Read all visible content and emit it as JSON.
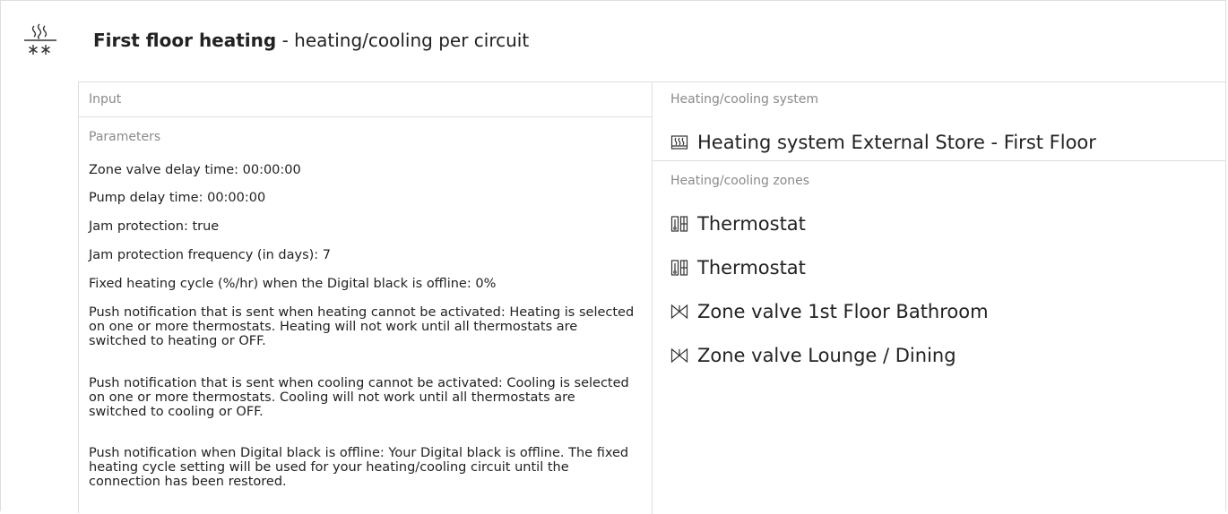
{
  "header": {
    "title_bold": "First floor heating",
    "title_rest": " - heating/cooling per circuit",
    "icon": "heating-cooling-icon"
  },
  "left": {
    "input_label": "Input",
    "parameters_label": "Parameters",
    "parameters": [
      "Zone valve delay time: 00:00:00",
      "Pump delay time: 00:00:00",
      "Jam protection: true",
      "Jam protection frequency (in days): 7",
      "Fixed heating cycle (%/hr) when the Digital black is offline: 0%",
      "Push notification that is sent when heating cannot be activated: Heating is selected on one or more thermostats. Heating will not work until all thermostats are switched to heating or OFF.",
      "Push notification that is sent when cooling cannot be activated: Cooling is selected on one or more thermostats. Cooling will not work until all thermostats are switched to cooling or OFF.",
      "Push notification when Digital black is offline: Your Digital black is offline. The fixed heating cycle setting will be used for your heating/cooling circuit until the connection has been restored."
    ]
  },
  "right": {
    "system_label": "Heating/cooling system",
    "system_name": "Heating system External Store - First Floor",
    "zones_label": "Heating/cooling zones",
    "zones": [
      {
        "label": "Thermostat",
        "icon": "thermostat-icon"
      },
      {
        "label": "Thermostat",
        "icon": "thermostat-icon"
      },
      {
        "label": "Zone valve 1st Floor Bathroom",
        "icon": "valve-icon"
      },
      {
        "label": "Zone valve Lounge / Dining",
        "icon": "valve-icon"
      }
    ]
  }
}
